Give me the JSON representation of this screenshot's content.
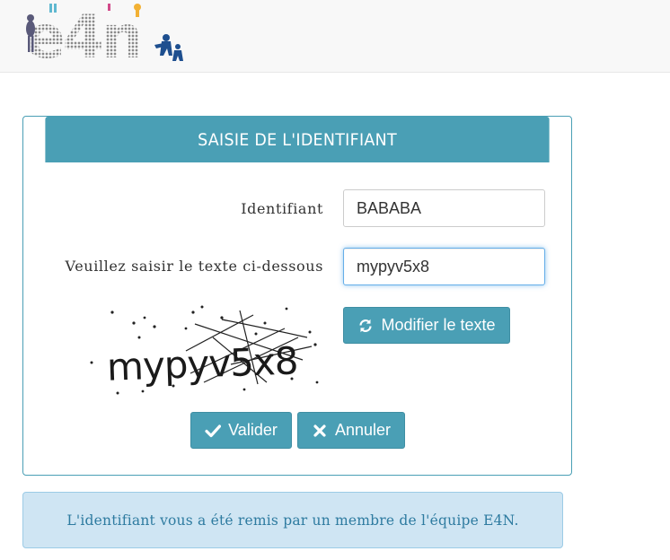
{
  "header": {
    "logo_text": "e4n"
  },
  "panel": {
    "title": "SAISIE DE L'IDENTIFIANT",
    "identifiant_label": "Identifiant",
    "identifiant_value": "BABABA",
    "captcha_label": "Veuillez saisir le texte ci-dessous",
    "captcha_value": "mypyv5x8",
    "captcha_image_text": "mypyv5x8",
    "refresh_label": "Modifier le texte",
    "submit_label": "Valider",
    "cancel_label": "Annuler"
  },
  "info": {
    "message": "L'identifiant vous a été remis par un membre de l'équipe E4N."
  },
  "icons": {
    "refresh": "refresh-icon",
    "submit": "check-icon",
    "cancel": "close-icon"
  },
  "colors": {
    "accent": "#4a9fb5",
    "info_background": "#cfe5f3",
    "info_text": "#2e7ba0"
  }
}
